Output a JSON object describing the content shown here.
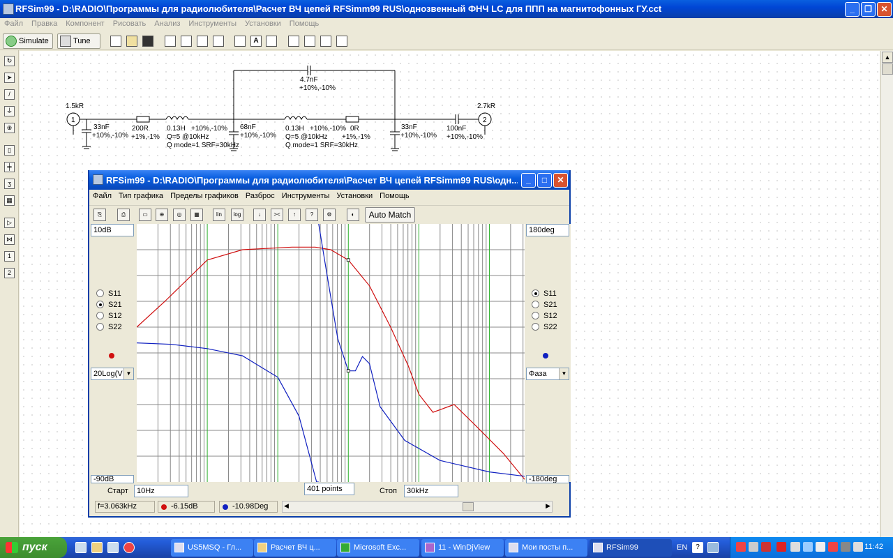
{
  "main_window": {
    "title": "RFSim99 - D:\\RADIO\\Программы для радиолюбителя\\Расчет ВЧ цепей RFSimm99 RUS\\однозвенный ФНЧ LC для ППП на магнитофонных ГУ.cct",
    "menu": [
      "Файл",
      "Правка",
      "Компонент",
      "Рисовать",
      "Анализ",
      "Инструменты",
      "Установки",
      "Помощь"
    ],
    "toolbar": {
      "simulate": "Simulate",
      "tune": "Tune"
    }
  },
  "schematic": {
    "labels": [
      "1.5kR",
      "33nF",
      "+10%,-10%",
      "200R",
      "+1%,-1%",
      "0.13H",
      "+10%,-10%",
      "Q=5 @10kHz",
      "Q mode=1 SRF=30kHz",
      "68nF",
      "+10%,-10%",
      "0.13H",
      "+10%,-10%",
      "Q=5 @10kHz",
      "Q mode=1 SRF=30kHz",
      "0R",
      "+1%,-1%",
      "33nF",
      "+10%,-10%",
      "100nF",
      "+10%,-10%",
      "2.7kR",
      "4.7nF",
      "+10%,-10%"
    ],
    "port1": "1",
    "port2": "2"
  },
  "graph_window": {
    "title": "RFSim99 - D:\\RADIO\\Программы для радиолюбителя\\Расчет ВЧ цепей RFSimm99 RUS\\одн...",
    "menu": [
      "Файл",
      "Тип графика",
      "Пределы графиков",
      "Разброс",
      "Инструменты",
      "Установки",
      "Помощь"
    ],
    "auto_match": "Auto Match",
    "left": {
      "top_scale": "10dB",
      "bottom_scale": "-90dB",
      "params": [
        "S11",
        "S21",
        "S12",
        "S22"
      ],
      "selected": "S21",
      "mode": "20Log(V",
      "color": "#d01010"
    },
    "right": {
      "top_scale": "180deg",
      "bottom_scale": "-180deg",
      "params": [
        "S11",
        "S21",
        "S12",
        "S22"
      ],
      "selected": "S11",
      "mode": "Фаза",
      "color": "#1020c0"
    },
    "start_label": "Старт",
    "start_value": "10Hz",
    "points": "401 points",
    "stop_label": "Стоп",
    "stop_value": "30kHz",
    "status": {
      "freq": "f=3.063kHz",
      "mag": "-6.15dB",
      "phase": "-10.98Deg"
    }
  },
  "chart_data": {
    "type": "line",
    "x_scale": "log",
    "x_range": [
      "10Hz",
      "30kHz"
    ],
    "y_left": {
      "unit": "dB",
      "range": [
        -90,
        10
      ]
    },
    "y_right": {
      "unit": "deg",
      "range": [
        -180,
        180
      ]
    },
    "grid": true,
    "series": [
      {
        "axis": "left",
        "color": "#d01010",
        "points": [
          [
            0,
            -30
          ],
          [
            0.4,
            -20
          ],
          [
            1.0,
            -4
          ],
          [
            1.5,
            0
          ],
          [
            2.2,
            1
          ],
          [
            2.53,
            1
          ],
          [
            2.75,
            0
          ],
          [
            3.0,
            -4
          ],
          [
            3.3,
            -14
          ],
          [
            3.6,
            -30
          ],
          [
            3.85,
            -45
          ],
          [
            4.0,
            -56
          ],
          [
            4.2,
            -63
          ],
          [
            4.5,
            -60
          ],
          [
            4.8,
            -68
          ],
          [
            5.2,
            -79
          ],
          [
            5.5,
            -89
          ]
        ]
      },
      {
        "axis": "right",
        "color": "#1020c0",
        "points": [
          [
            0,
            14
          ],
          [
            0.5,
            12
          ],
          [
            1.0,
            6
          ],
          [
            1.5,
            -4
          ],
          [
            2.0,
            -34
          ],
          [
            2.3,
            -88
          ],
          [
            2.55,
            -180
          ],
          [
            2.58,
            180
          ],
          [
            2.7,
            108
          ],
          [
            2.85,
            20
          ],
          [
            3.0,
            -25
          ],
          [
            3.1,
            -25
          ],
          [
            3.2,
            -5
          ],
          [
            3.3,
            -15
          ],
          [
            3.45,
            -75
          ],
          [
            3.8,
            -122
          ],
          [
            4.3,
            -150
          ],
          [
            5.0,
            -166
          ],
          [
            5.5,
            -172
          ]
        ]
      }
    ],
    "marker_x": 3.0
  },
  "taskbar": {
    "start": "пуск",
    "tasks": [
      "US5MSQ - Гл...",
      "Расчет ВЧ ц...",
      "Microsoft Exc...",
      "11 - WinDjView",
      "Мои посты п...",
      "RFSim99"
    ],
    "lang": "EN",
    "clock": "11:42"
  }
}
